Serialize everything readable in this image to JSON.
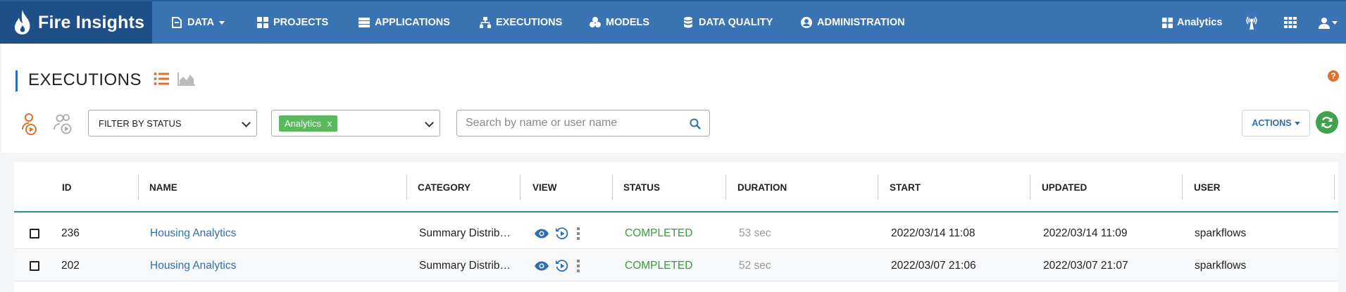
{
  "brand": {
    "name": "Fire Insights"
  },
  "nav": {
    "items": [
      {
        "label": "DATA",
        "icon": "data-icon"
      },
      {
        "label": "PROJECTS",
        "icon": "grid-icon"
      },
      {
        "label": "APPLICATIONS",
        "icon": "server-icon"
      },
      {
        "label": "EXECUTIONS",
        "icon": "sitemap-icon"
      },
      {
        "label": "MODELS",
        "icon": "cubes-icon"
      },
      {
        "label": "DATA QUALITY",
        "icon": "database-icon"
      },
      {
        "label": "ADMINISTRATION",
        "icon": "user-circle-icon"
      }
    ],
    "workspace_label": "Analytics"
  },
  "page": {
    "title": "EXECUTIONS"
  },
  "filters": {
    "status_label": "FILTER BY STATUS",
    "tag_label": "Analytics",
    "tag_remove": "x",
    "search_placeholder": "Search by name or user name",
    "actions_label": "ACTIONS",
    "help": "?"
  },
  "table": {
    "columns": [
      "ID",
      "NAME",
      "CATEGORY",
      "VIEW",
      "STATUS",
      "DURATION",
      "START",
      "UPDATED",
      "USER"
    ],
    "rows": [
      {
        "id": "236",
        "name": "Housing Analytics",
        "category": "Summary Distribu...",
        "status": "COMPLETED",
        "duration": "53 sec",
        "start": "2022/03/14 11:08",
        "updated": "2022/03/14 11:09",
        "user": "sparkflows"
      },
      {
        "id": "202",
        "name": "Housing Analytics",
        "category": "Summary Distribu...",
        "status": "COMPLETED",
        "duration": "52 sec",
        "start": "2022/03/07 21:06",
        "updated": "2022/03/07 21:07",
        "user": "sparkflows"
      }
    ]
  },
  "colors": {
    "nav": "#3a74b4",
    "brand_bg": "#1f4f87",
    "accent": "#2f6fb0",
    "success": "#3a9a3a",
    "orange": "#e0702a"
  }
}
